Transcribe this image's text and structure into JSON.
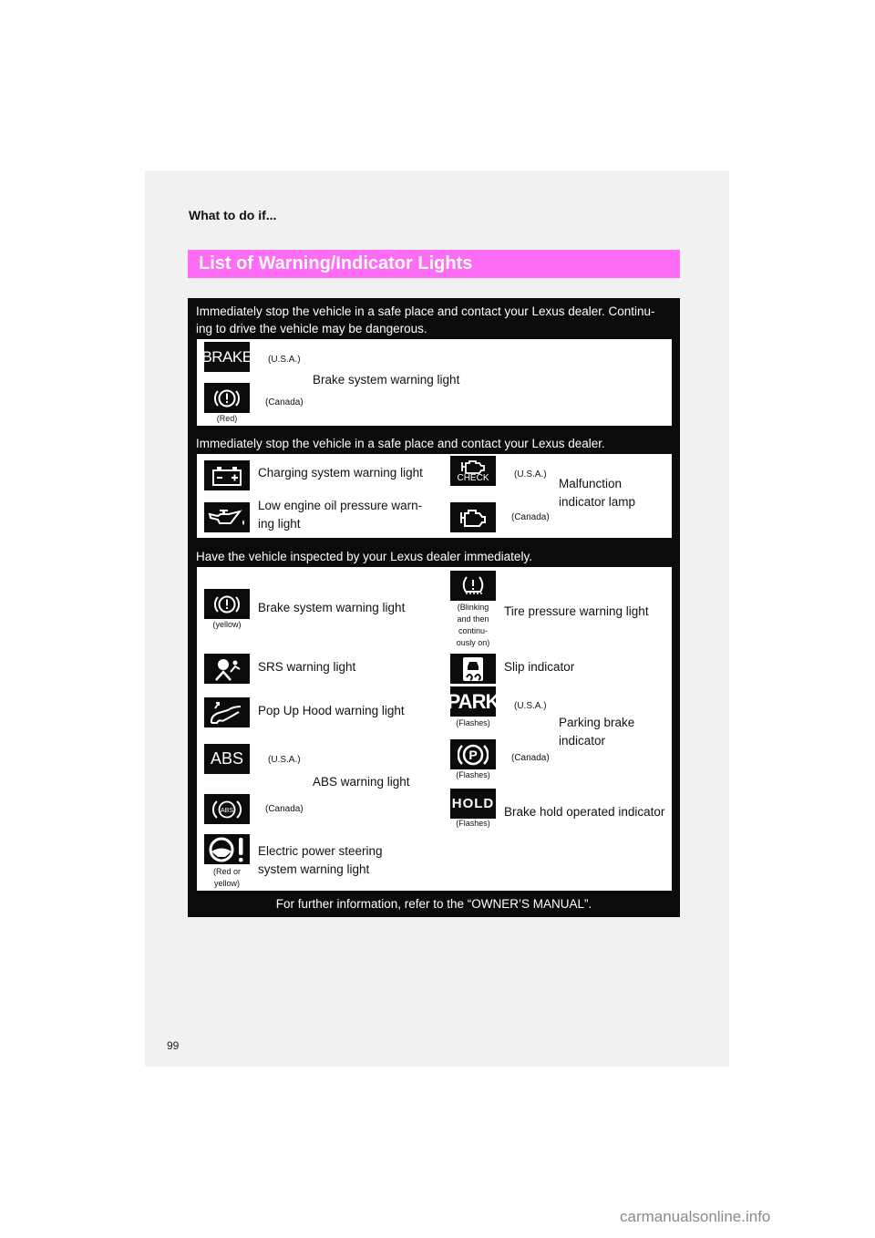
{
  "section_label": "What to do if...",
  "title": "List of Warning/Indicator Lights",
  "groups": [
    {
      "header": "Immediately stop the vehicle in a safe place and contact your Lexus dealer. Continu-ing to drive the vehicle may be dangerous.",
      "header_line1": "Immediately stop the vehicle in a safe place and contact your Lexus dealer. Continu-",
      "header_line2": "ing to drive the vehicle may be dangerous.",
      "items": [
        {
          "label": "Brake system warning light",
          "variants": [
            {
              "icon": "brake-text-icon",
              "icon_text": "BRAKE",
              "region": "(U.S.A.)"
            },
            {
              "icon": "brake-exclamation-icon",
              "region": "(Canada)",
              "color_note": "(Red)"
            }
          ]
        }
      ]
    },
    {
      "header": "Immediately stop the vehicle in a safe place and contact your Lexus dealer.",
      "items": [
        {
          "label": "Charging system warning light",
          "icon": "battery-icon"
        },
        {
          "label_line1": "Low engine oil pressure warn-",
          "label_line2": "ing light",
          "icon": "oil-can-icon"
        },
        {
          "label_line1": "Malfunction",
          "label_line2": "indicator lamp",
          "variants": [
            {
              "icon": "engine-check-icon",
              "icon_text": "CHECK",
              "region": "(U.S.A.)"
            },
            {
              "icon": "engine-icon",
              "region": "(Canada)"
            }
          ]
        }
      ]
    },
    {
      "header": "Have the vehicle inspected by your Lexus dealer immediately.",
      "items": [
        {
          "label": "Brake system warning light",
          "icon": "brake-exclamation-icon",
          "note": "(yellow)"
        },
        {
          "label": "Tire pressure warning light",
          "icon": "tire-pressure-icon",
          "note_lines": [
            "(Blinking",
            "and then",
            "continu-",
            "ously on)"
          ]
        },
        {
          "label": "SRS warning light",
          "icon": "airbag-icon"
        },
        {
          "label": "Slip indicator",
          "icon": "slip-icon"
        },
        {
          "label": "Pop Up Hood warning light",
          "icon": "pop-up-hood-icon"
        },
        {
          "label_line1": "Parking brake",
          "label_line2": "indicator",
          "variants": [
            {
              "icon": "park-text-icon",
              "icon_text": "PARK",
              "region": "(U.S.A.)",
              "note": "(Flashes)"
            },
            {
              "icon": "parking-p-icon",
              "icon_text": "P",
              "region": "(Canada)",
              "note": "(Flashes)"
            }
          ]
        },
        {
          "label": "ABS warning light",
          "variants": [
            {
              "icon": "abs-text-icon",
              "icon_text": "ABS",
              "region": "(U.S.A.)"
            },
            {
              "icon": "abs-circle-icon",
              "icon_text": "ABS",
              "region": "(Canada)"
            }
          ]
        },
        {
          "label": "Brake hold operated indicator",
          "icon": "hold-icon",
          "icon_text": "HOLD",
          "note": "(Flashes)"
        },
        {
          "label_line1": "Electric power steering",
          "label_line2": "system warning light",
          "icon": "steering-warning-icon",
          "note_lines": [
            "(Red or",
            "yellow)"
          ]
        }
      ]
    }
  ],
  "footer": "For further information, refer to the “OWNER’S MANUAL”.",
  "page_number": "99",
  "watermark": "carmanualsonline.info",
  "colors": {
    "title_bar": "#ff6cf5",
    "box": "#0b0b0b",
    "page": "#f0f1f0"
  }
}
